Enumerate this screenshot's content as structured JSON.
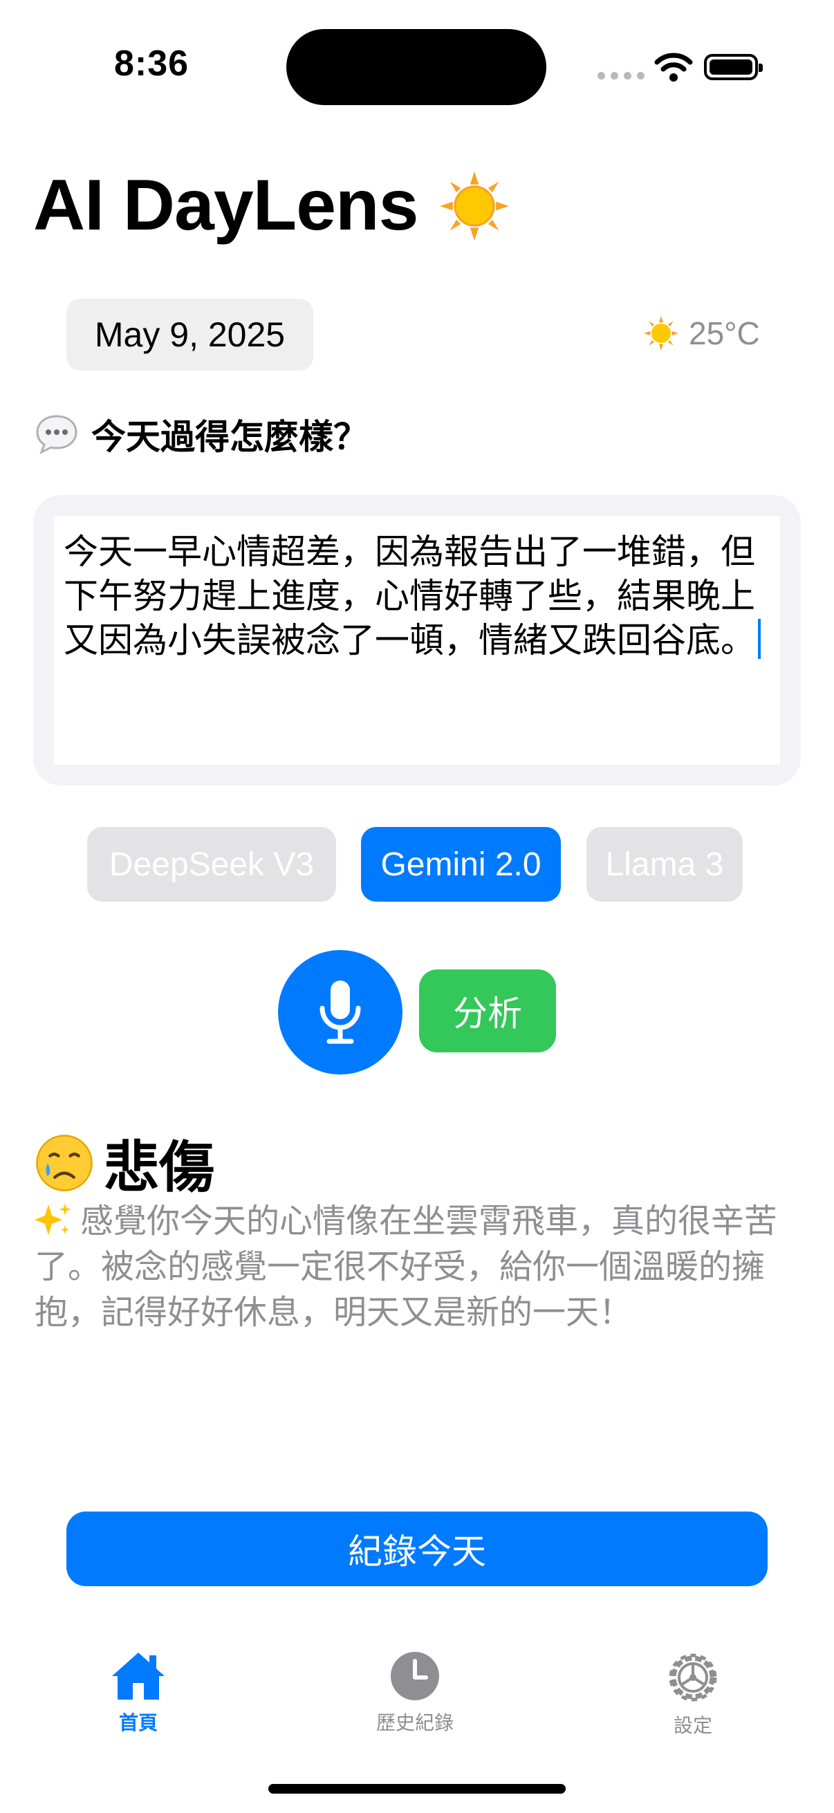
{
  "status_bar": {
    "time": "8:36"
  },
  "app": {
    "title": "AI DayLens",
    "title_icon": "sun-emoji"
  },
  "date": "May 9, 2025",
  "weather": {
    "icon": "sun-emoji",
    "temperature": "25°C"
  },
  "prompt": {
    "icon": "speech-bubble-icon",
    "text": "今天過得怎麼樣？"
  },
  "entry": {
    "text": "今天一早心情超差，因為報告出了一堆錯，但下午努力趕上進度，心情好轉了些，結果晚上又因為小失誤被念了一頓，情緒又跌回谷底。"
  },
  "models": [
    {
      "label": "DeepSeek V3",
      "selected": false
    },
    {
      "label": "Gemini 2.0",
      "selected": true
    },
    {
      "label": "Llama 3",
      "selected": false
    }
  ],
  "actions": {
    "analyze_label": "分析",
    "mic_icon": "microphone-icon"
  },
  "result": {
    "mood_icon": "crying-face-emoji",
    "mood": "悲傷",
    "message_icon": "sparkles-emoji",
    "message": "感覺你今天的心情像在坐雲霄飛車，真的很辛苦了。被念的感覺一定很不好受，給你一個溫暖的擁抱，記得好好休息，明天又是新的一天！"
  },
  "record_button": "紀錄今天",
  "tabs": [
    {
      "label": "首頁",
      "icon": "house-icon",
      "active": true
    },
    {
      "label": "歷史紀錄",
      "icon": "clock-icon",
      "active": false
    },
    {
      "label": "設定",
      "icon": "gear-icon",
      "active": false
    }
  ],
  "colors": {
    "accent": "#007aff",
    "green": "#34c759",
    "gray": "#8e8e93"
  }
}
